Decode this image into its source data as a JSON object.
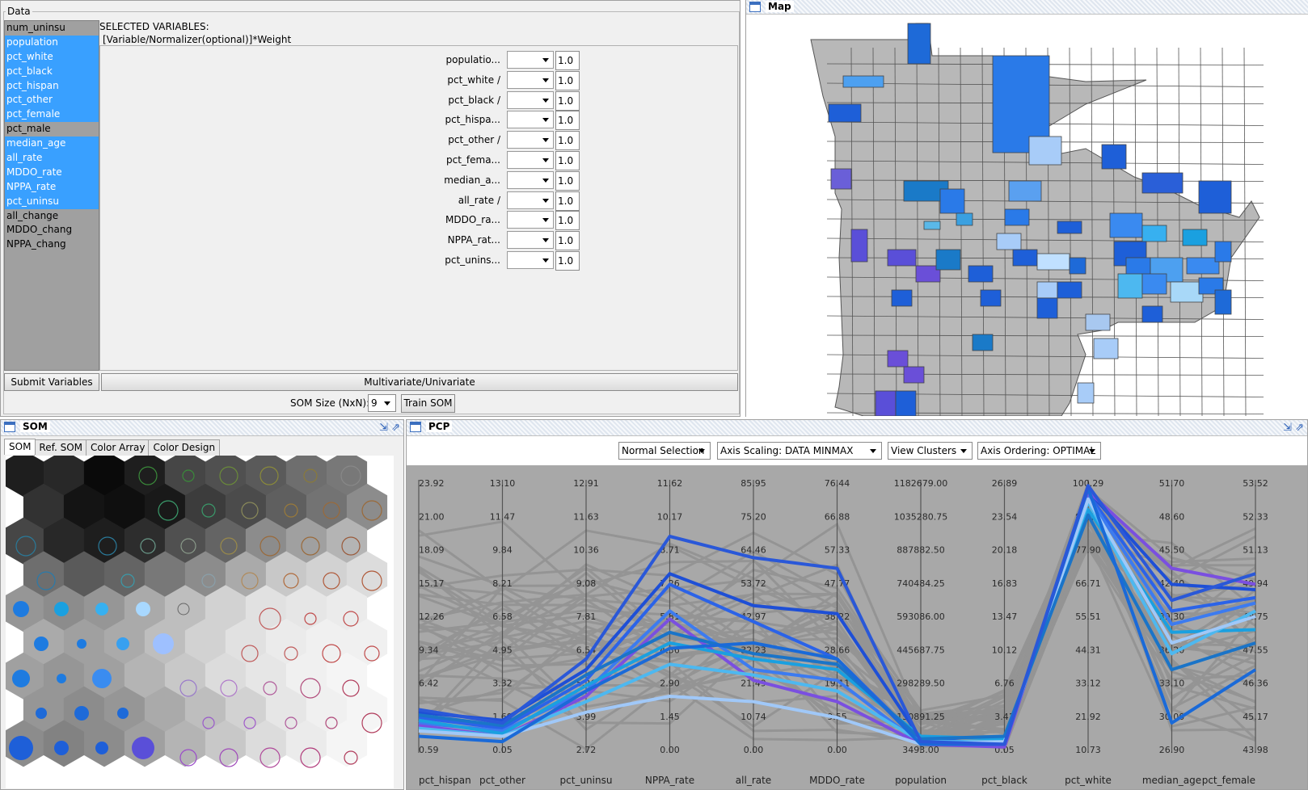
{
  "data_panel": {
    "legend": "Data",
    "variables": [
      {
        "name": "num_uninsu",
        "selected": false
      },
      {
        "name": "population",
        "selected": true
      },
      {
        "name": "pct_white",
        "selected": true
      },
      {
        "name": "pct_black",
        "selected": true
      },
      {
        "name": "pct_hispan",
        "selected": true
      },
      {
        "name": "pct_other",
        "selected": true
      },
      {
        "name": "pct_female",
        "selected": true
      },
      {
        "name": "pct_male",
        "selected": false
      },
      {
        "name": "median_age",
        "selected": true
      },
      {
        "name": "all_rate",
        "selected": true
      },
      {
        "name": "MDDO_rate",
        "selected": true
      },
      {
        "name": "NPPA_rate",
        "selected": true
      },
      {
        "name": "pct_uninsu",
        "selected": true
      },
      {
        "name": "all_change",
        "selected": false
      },
      {
        "name": "MDDO_chang",
        "selected": false
      },
      {
        "name": "NPPA_chang",
        "selected": false
      }
    ],
    "selected_header_1": "SELECTED VARIABLES:",
    "selected_header_2": "[Variable/Normalizer(optional)]*Weight",
    "rows": [
      {
        "label": "populatio...",
        "weight": "1.0"
      },
      {
        "label": "pct_white /",
        "weight": "1.0"
      },
      {
        "label": "pct_black /",
        "weight": "1.0"
      },
      {
        "label": "pct_hispa...",
        "weight": "1.0"
      },
      {
        "label": "pct_other /",
        "weight": "1.0"
      },
      {
        "label": "pct_fema...",
        "weight": "1.0"
      },
      {
        "label": "median_a...",
        "weight": "1.0"
      },
      {
        "label": "all_rate /",
        "weight": "1.0"
      },
      {
        "label": "MDDO_ra...",
        "weight": "1.0"
      },
      {
        "label": "NPPA_rat...",
        "weight": "1.0"
      },
      {
        "label": "pct_unins...",
        "weight": "1.0"
      }
    ],
    "submit_label": "Submit Variables",
    "multivariate_label": "Multivariate/Univariate",
    "som_size_label": "SOM Size (NxN):",
    "som_size_value": "9",
    "train_label": "Train SOM"
  },
  "map_panel": {
    "title": "Map"
  },
  "som_panel": {
    "title": "SOM",
    "tabs": [
      "SOM",
      "Ref. SOM",
      "Color Array",
      "Color Design"
    ],
    "active_tab": 0
  },
  "pcp_panel": {
    "title": "PCP",
    "dropdowns": [
      "Normal Selection",
      "Axis Scaling: DATA MINMAX",
      "View Clusters",
      "Axis Ordering: OPTIMAL"
    ]
  },
  "chart_data": {
    "type": "line",
    "axes": [
      {
        "name": "pct_hispan",
        "ticks": [
          "23.92",
          "21.00",
          "18.09",
          "15.17",
          "12.26",
          "9.34",
          "6.42",
          "3.51",
          "0.59"
        ]
      },
      {
        "name": "pct_other",
        "ticks": [
          "13.10",
          "11.47",
          "9.84",
          "8.21",
          "6.58",
          "4.95",
          "3.32",
          "1.69",
          "0.05"
        ]
      },
      {
        "name": "pct_uninsu",
        "ticks": [
          "12.91",
          "11.63",
          "10.36",
          "9.08",
          "7.81",
          "6.54",
          "5.26",
          "3.99",
          "2.72"
        ]
      },
      {
        "name": "NPPA_rate",
        "ticks": [
          "11.62",
          "10.17",
          "8.71",
          "7.26",
          "5.81",
          "4.36",
          "2.90",
          "1.45",
          "0.00"
        ]
      },
      {
        "name": "all_rate",
        "ticks": [
          "85.95",
          "75.20",
          "64.46",
          "53.72",
          "42.97",
          "32.23",
          "21.49",
          "10.74",
          "0.00"
        ]
      },
      {
        "name": "MDDO_rate",
        "ticks": [
          "76.44",
          "66.88",
          "57.33",
          "47.77",
          "38.22",
          "28.66",
          "19.11",
          "9.55",
          "0.00"
        ]
      },
      {
        "name": "population",
        "ticks": [
          "1182679.00",
          "1035280.75",
          "887882.50",
          "740484.25",
          "593086.00",
          "445687.75",
          "298289.50",
          "150891.25",
          "3493.00"
        ]
      },
      {
        "name": "pct_black",
        "ticks": [
          "26.89",
          "23.54",
          "20.18",
          "16.83",
          "13.47",
          "10.12",
          "6.76",
          "3.41",
          "0.05"
        ]
      },
      {
        "name": "pct_white",
        "ticks": [
          "100.29",
          "88.10",
          "77.90",
          "66.71",
          "55.51",
          "44.31",
          "33.12",
          "21.92",
          "10.73"
        ]
      },
      {
        "name": "median_age",
        "ticks": [
          "51.70",
          "48.60",
          "45.50",
          "42.40",
          "39.30",
          "36.20",
          "33.10",
          "30.00",
          "26.90"
        ]
      },
      {
        "name": "pct_female",
        "ticks": [
          "53.52",
          "52.33",
          "51.13",
          "49.94",
          "48.75",
          "47.55",
          "46.36",
          "45.17",
          "43.98"
        ]
      }
    ],
    "highlighted_series": [
      {
        "color": "#1e4fd6",
        "values": [
          0.14,
          0.11,
          0.3,
          0.66,
          0.54,
          0.51,
          0.04,
          0.02,
          0.97,
          0.62,
          0.6
        ]
      },
      {
        "color": "#2b63e8",
        "values": [
          0.12,
          0.08,
          0.26,
          0.62,
          0.48,
          0.34,
          0.03,
          0.02,
          0.96,
          0.52,
          0.57
        ]
      },
      {
        "color": "#3c7bf0",
        "values": [
          0.1,
          0.07,
          0.22,
          0.52,
          0.3,
          0.26,
          0.02,
          0.02,
          0.95,
          0.47,
          0.55
        ]
      },
      {
        "color": "#7a4fe0",
        "values": [
          0.09,
          0.05,
          0.2,
          0.49,
          0.26,
          0.18,
          0.02,
          0.01,
          0.97,
          0.68,
          0.62
        ]
      },
      {
        "color": "#1aa0e0",
        "values": [
          0.11,
          0.06,
          0.24,
          0.4,
          0.34,
          0.3,
          0.05,
          0.04,
          0.9,
          0.44,
          0.45
        ]
      },
      {
        "color": "#4db8f0",
        "values": [
          0.08,
          0.05,
          0.18,
          0.32,
          0.28,
          0.22,
          0.03,
          0.03,
          0.93,
          0.36,
          0.52
        ]
      },
      {
        "color": "#a0c8f8",
        "values": [
          0.07,
          0.05,
          0.14,
          0.2,
          0.18,
          0.12,
          0.02,
          0.03,
          0.94,
          0.4,
          0.5
        ]
      },
      {
        "color": "#1a74c8",
        "values": [
          0.13,
          0.09,
          0.28,
          0.44,
          0.36,
          0.32,
          0.04,
          0.05,
          0.88,
          0.3,
          0.4
        ]
      },
      {
        "color": "#1a6ad8",
        "values": [
          0.05,
          0.03,
          0.22,
          0.38,
          0.4,
          0.34,
          0.02,
          0.02,
          0.98,
          0.1,
          0.3
        ]
      },
      {
        "color": "#2a58d8",
        "values": [
          0.15,
          0.1,
          0.34,
          0.8,
          0.72,
          0.68,
          0.03,
          0.02,
          0.99,
          0.56,
          0.66
        ]
      }
    ]
  }
}
